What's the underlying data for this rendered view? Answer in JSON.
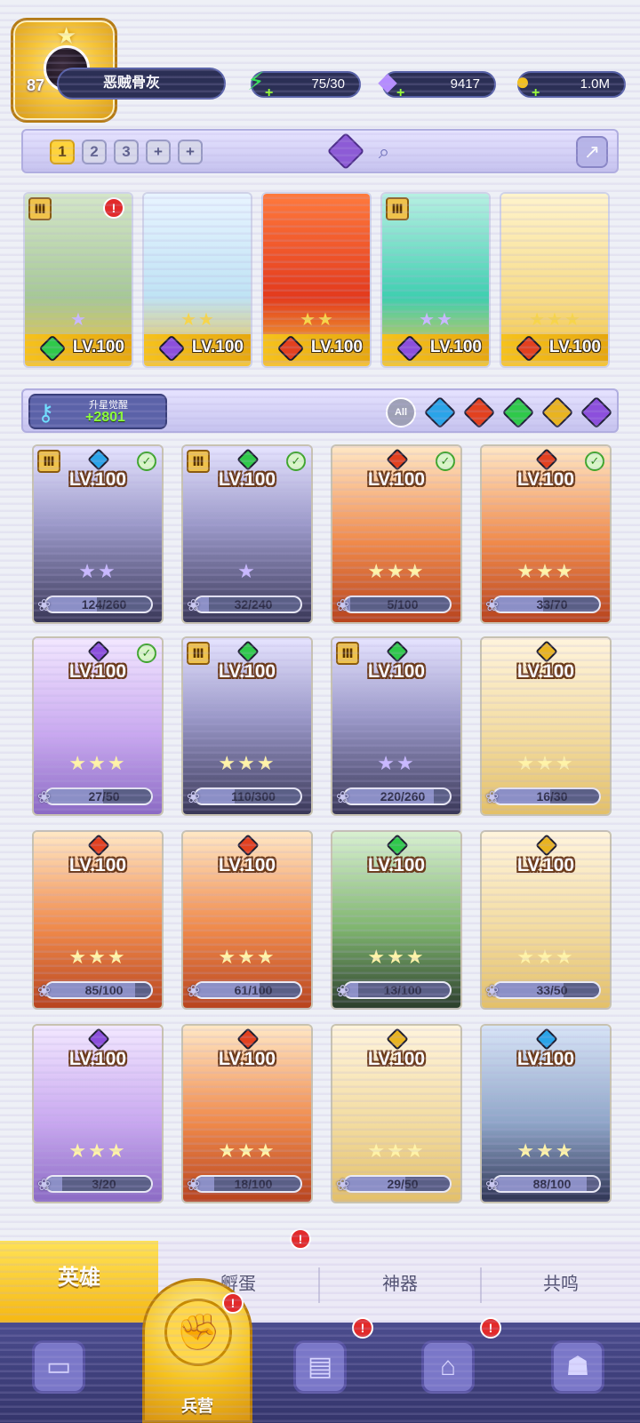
{
  "player": {
    "level": "87",
    "name": "恶贼骨灰"
  },
  "resources": {
    "energy": "75/30",
    "gems": "9417",
    "coins": "1.0M"
  },
  "team_slots": [
    "1",
    "2",
    "3",
    "+",
    "+"
  ],
  "team": [
    {
      "level_label": "LV.100",
      "stars": "★",
      "element": "green",
      "alert": "!"
    },
    {
      "level_label": "LV.100",
      "stars": "★★",
      "element": "purple"
    },
    {
      "level_label": "LV.100",
      "stars": "★★",
      "element": "red"
    },
    {
      "level_label": "LV.100",
      "stars": "★★",
      "element": "purple"
    },
    {
      "level_label": "LV.100",
      "stars": "★★★",
      "element": "red"
    }
  ],
  "upgrade_key": {
    "label": "升星觉醒",
    "value": "+2801"
  },
  "filters": {
    "all_label": "All",
    "elements": [
      "blue",
      "red",
      "green",
      "gold",
      "purple"
    ]
  },
  "heroes": [
    {
      "level_label": "LV.100",
      "stars": "★★",
      "progress": "124/260",
      "fraction": 0.48,
      "element": "blue",
      "checked": true,
      "medal": true
    },
    {
      "level_label": "LV.100",
      "stars": "★",
      "progress": "32/240",
      "fraction": 0.13,
      "element": "green",
      "checked": true,
      "medal": true
    },
    {
      "level_label": "LV.100",
      "stars": "★★★",
      "progress": "5/100",
      "fraction": 0.05,
      "element": "red",
      "checked": true,
      "medal": false
    },
    {
      "level_label": "LV.100",
      "stars": "★★★",
      "progress": "33/70",
      "fraction": 0.47,
      "element": "red",
      "checked": true,
      "medal": false
    },
    {
      "level_label": "LV.100",
      "stars": "★★★",
      "progress": "27/50",
      "fraction": 0.54,
      "element": "purple",
      "checked": true,
      "medal": false
    },
    {
      "level_label": "LV.100",
      "stars": "★★★",
      "progress": "110/300",
      "fraction": 0.37,
      "element": "green",
      "checked": false,
      "medal": true
    },
    {
      "level_label": "LV.100",
      "stars": "★★",
      "progress": "220/260",
      "fraction": 0.85,
      "element": "green",
      "checked": false,
      "medal": true
    },
    {
      "level_label": "LV.100",
      "stars": "★★★",
      "progress": "16/30",
      "fraction": 0.53,
      "element": "gold",
      "checked": false,
      "medal": false
    },
    {
      "level_label": "LV.100",
      "stars": "★★★",
      "progress": "85/100",
      "fraction": 0.85,
      "element": "red",
      "checked": false,
      "medal": false
    },
    {
      "level_label": "LV.100",
      "stars": "★★★",
      "progress": "61/100",
      "fraction": 0.61,
      "element": "red",
      "checked": false,
      "medal": false
    },
    {
      "level_label": "LV.100",
      "stars": "★★★",
      "progress": "13/100",
      "fraction": 0.13,
      "element": "green",
      "checked": false,
      "medal": false
    },
    {
      "level_label": "LV.100",
      "stars": "★★★",
      "progress": "33/50",
      "fraction": 0.66,
      "element": "gold",
      "checked": false,
      "medal": false
    },
    {
      "level_label": "LV.100",
      "stars": "★★★",
      "progress": "3/20",
      "fraction": 0.15,
      "element": "purple",
      "checked": false,
      "medal": false
    },
    {
      "level_label": "LV.100",
      "stars": "★★★",
      "progress": "18/100",
      "fraction": 0.18,
      "element": "red",
      "checked": false,
      "medal": false
    },
    {
      "level_label": "LV.100",
      "stars": "★★★",
      "progress": "29/50",
      "fraction": 0.58,
      "element": "gold",
      "checked": false,
      "medal": false
    },
    {
      "level_label": "LV.100",
      "stars": "★★★",
      "progress": "88/100",
      "fraction": 0.88,
      "element": "blue",
      "checked": false,
      "medal": false
    }
  ],
  "subtabs": [
    "英雄",
    "孵蛋",
    "神器",
    "共鸣"
  ],
  "bottom_nav": {
    "active_label": "兵营"
  },
  "colors": {
    "green": "#2fc94a",
    "purple": "#8c4fdc",
    "red": "#e2411f",
    "blue": "#2aa4e8",
    "gold": "#e9b420"
  }
}
